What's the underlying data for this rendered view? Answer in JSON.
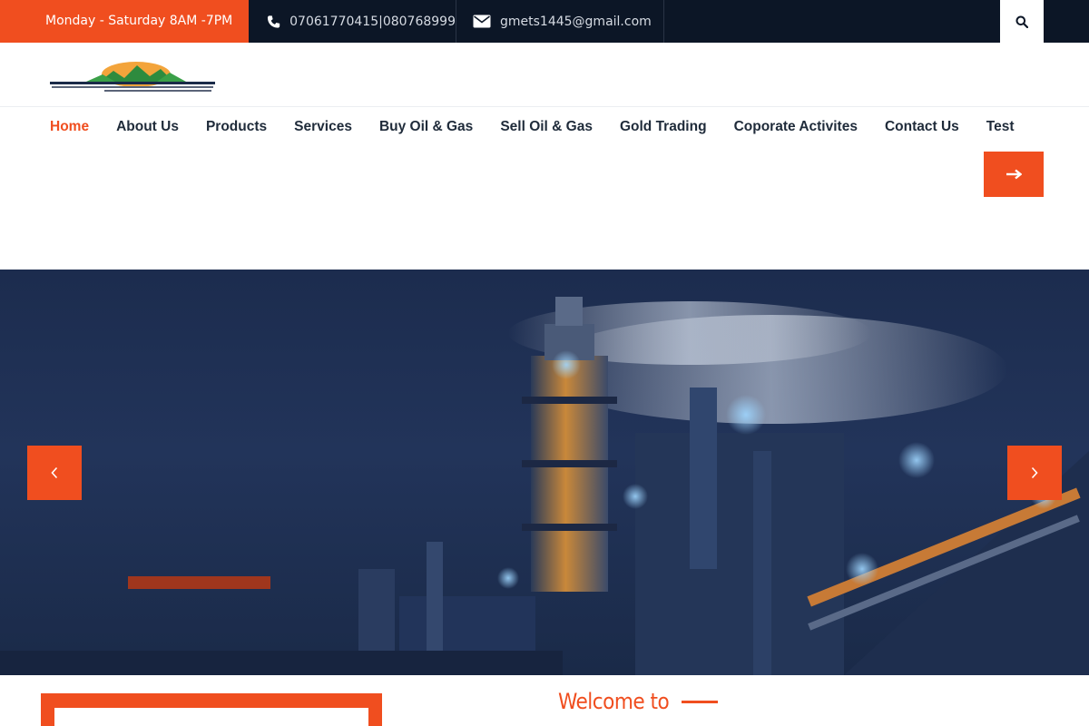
{
  "topbar": {
    "hours": "Monday - Saturday 8AM -7PM",
    "phone": "07061770415|080768999",
    "email": "gmets1445@gmail.com"
  },
  "logo": {
    "alt": "Global Mining & Explorations Technology Solutions Ltd logo"
  },
  "nav": {
    "items": [
      {
        "label": "Home",
        "active": true
      },
      {
        "label": "About Us"
      },
      {
        "label": "Products"
      },
      {
        "label": "Services"
      },
      {
        "label": "Buy Oil & Gas"
      },
      {
        "label": "Sell Oil & Gas"
      },
      {
        "label": "Gold Trading"
      },
      {
        "label": "Coporate Activites"
      },
      {
        "label": "Contact Us"
      },
      {
        "label": "Test"
      }
    ]
  },
  "icons": {
    "phone": "phone-icon",
    "email": "envelope-icon",
    "search": "search-icon",
    "cta": "arrow-right-icon",
    "prev": "chevron-left-icon",
    "next": "chevron-right-icon"
  },
  "colors": {
    "accent": "#f04e1f",
    "topbar": "#0c1626",
    "nav_text": "#1f2b3a"
  },
  "welcome": {
    "heading": "Welcome to"
  }
}
